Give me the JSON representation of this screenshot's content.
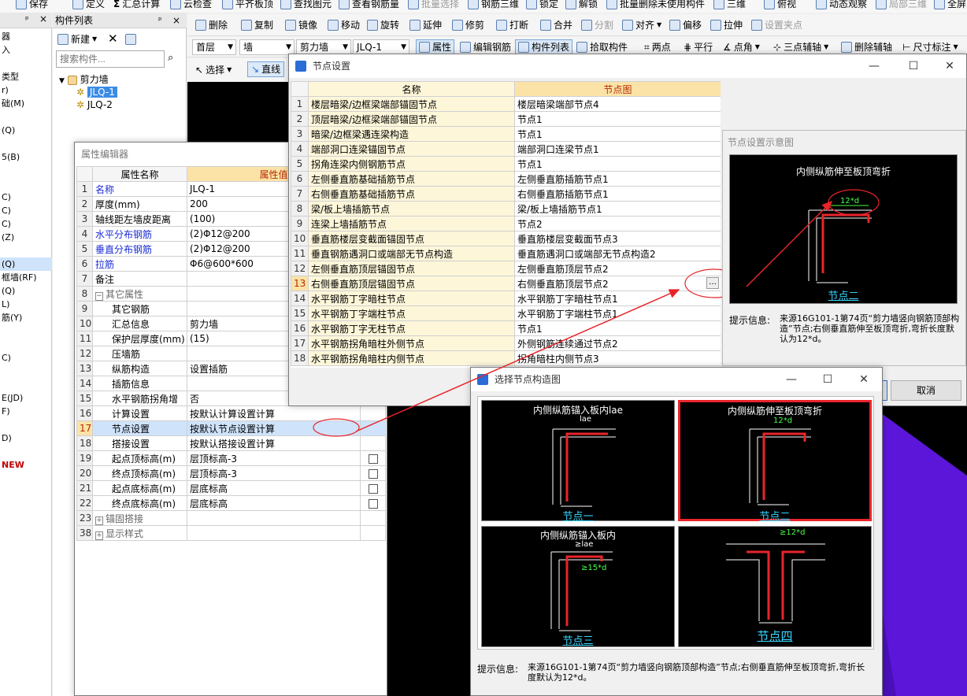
{
  "toolbar1": {
    "save": "保存",
    "define": "定义",
    "sum": "汇总计算",
    "cloud_check": "云检查",
    "flat_slab": "平齐板顶",
    "find": "查找图元",
    "view_rebar": "查看钢筋量",
    "batch_select": "批量选择",
    "rebar_3d": "钢筋三维",
    "lock": "锁定",
    "unlock": "解锁",
    "batch_delete": "批量删除未使用构件",
    "three_d": "三维",
    "top_view": "俯视",
    "dynamic": "动态观察",
    "local_3d": "局部三维",
    "full": "全屏"
  },
  "toolbar2": {
    "delete": "删除",
    "copy": "复制",
    "mirror": "镜像",
    "move": "移动",
    "rotate": "旋转",
    "extend": "延伸",
    "trim": "修剪",
    "break": "打断",
    "merge": "合并",
    "split": "分割",
    "align": "对齐",
    "offset": "偏移",
    "stretch": "拉伸",
    "set_corner": "设置夹点"
  },
  "toolbar3": {
    "floor": "首层",
    "type": "墙",
    "subtype": "剪力墙",
    "component": "JLQ-1",
    "property": "属性",
    "edit_rebar": "编辑钢筋",
    "comp_list": "构件列表",
    "pick": "拾取构件",
    "two_point": "两点",
    "parallel": "平行",
    "point_angle": "点角",
    "three_aux": "三点辅轴",
    "del_aux": "删除辅轴",
    "dim": "尺寸标注"
  },
  "toolbar4": {
    "select": "选择",
    "line": "直线"
  },
  "left_panel": {
    "items": [
      "器",
      "入",
      "",
      "类型",
      "r)",
      "础(M)",
      "",
      "(Q)",
      "",
      "5(B)",
      "",
      "",
      "C)",
      "C)",
      "C)",
      "(Z)",
      "",
      "(Q)",
      "框墙(RF)",
      "(Q)",
      "L)",
      "筋(Y)",
      "",
      "",
      "C)",
      "",
      "",
      "E(JD)",
      "F)",
      "",
      "D)",
      "",
      "NEW"
    ]
  },
  "comp_list": {
    "title": "构件列表",
    "new_btn": "新建",
    "search_placeholder": "搜索构件...",
    "tree_root": "剪力墙",
    "tree_items": [
      "JLQ-1",
      "JLQ-2"
    ]
  },
  "prop_editor": {
    "title": "属性编辑器",
    "col_name": "属性名称",
    "col_value": "属性值",
    "rows": [
      {
        "n": "1",
        "name": "名称",
        "value": "JLQ-1",
        "blue": true,
        "ind": 0
      },
      {
        "n": "2",
        "name": "厚度(mm)",
        "value": "200",
        "ind": 0
      },
      {
        "n": "3",
        "name": "轴线距左墙皮距离",
        "value": "(100)",
        "ind": 0
      },
      {
        "n": "4",
        "name": "水平分布钢筋",
        "value": "(2)Φ12@200",
        "blue": true,
        "ind": 0
      },
      {
        "n": "5",
        "name": "垂直分布钢筋",
        "value": "(2)Φ12@200",
        "blue": true,
        "ind": 0
      },
      {
        "n": "6",
        "name": "拉筋",
        "value": "Φ6@600*600",
        "blue": true,
        "ind": 0
      },
      {
        "n": "7",
        "name": "备注",
        "value": "",
        "ind": 0
      },
      {
        "n": "8",
        "name": "其它属性",
        "value": "",
        "group": "−",
        "ind": 0
      },
      {
        "n": "9",
        "name": "其它钢筋",
        "value": "",
        "ind": 1
      },
      {
        "n": "10",
        "name": "汇总信息",
        "value": "剪力墙",
        "ind": 1
      },
      {
        "n": "11",
        "name": "保护层厚度(mm)",
        "value": "(15)",
        "ind": 1
      },
      {
        "n": "12",
        "name": "压墙筋",
        "value": "",
        "ind": 1
      },
      {
        "n": "13",
        "name": "纵筋构造",
        "value": "设置插筋",
        "ind": 1
      },
      {
        "n": "14",
        "name": "插筋信息",
        "value": "",
        "ind": 1
      },
      {
        "n": "15",
        "name": "水平钢筋拐角增",
        "value": "否",
        "ind": 1
      },
      {
        "n": "16",
        "name": "计算设置",
        "value": "按默认计算设置计算",
        "ind": 1
      },
      {
        "n": "17",
        "name": "节点设置",
        "value": "按默认节点设置计算",
        "ind": 1,
        "sel": true
      },
      {
        "n": "18",
        "name": "搭接设置",
        "value": "按默认搭接设置计算",
        "ind": 1
      },
      {
        "n": "19",
        "name": "起点顶标高(m)",
        "value": "层顶标高-3",
        "ind": 1,
        "chk": true
      },
      {
        "n": "20",
        "name": "终点顶标高(m)",
        "value": "层顶标高-3",
        "ind": 1,
        "chk": true
      },
      {
        "n": "21",
        "name": "起点底标高(m)",
        "value": "层底标高",
        "ind": 1,
        "chk": true
      },
      {
        "n": "22",
        "name": "终点底标高(m)",
        "value": "层底标高",
        "ind": 1,
        "chk": true
      },
      {
        "n": "23",
        "name": "锚固搭接",
        "value": "",
        "group": "+",
        "ind": 0
      },
      {
        "n": "38",
        "name": "显示样式",
        "value": "",
        "group": "+",
        "ind": 0
      }
    ]
  },
  "node_dialog": {
    "title": "节点设置",
    "col_name": "名称",
    "col_node": "节点图",
    "cancel": "取消",
    "rows": [
      {
        "n": "1",
        "name": "楼层暗梁/边框梁端部锚固节点",
        "node": "楼层暗梁端部节点4"
      },
      {
        "n": "2",
        "name": "顶层暗梁/边框梁端部锚固节点",
        "node": "节点1"
      },
      {
        "n": "3",
        "name": "暗梁/边框梁遇连梁构造",
        "node": "节点1"
      },
      {
        "n": "4",
        "name": "端部洞口连梁锚固节点",
        "node": "端部洞口连梁节点1"
      },
      {
        "n": "5",
        "name": "拐角连梁内侧钢筋节点",
        "node": "节点1"
      },
      {
        "n": "6",
        "name": "左侧垂直筋基础插筋节点",
        "node": "左侧垂直筋插筋节点1"
      },
      {
        "n": "7",
        "name": "右侧垂直筋基础插筋节点",
        "node": "右侧垂直筋插筋节点1"
      },
      {
        "n": "8",
        "name": "梁/板上墙插筋节点",
        "node": "梁/板上墙插筋节点1"
      },
      {
        "n": "9",
        "name": "连梁上墙插筋节点",
        "node": "节点2"
      },
      {
        "n": "10",
        "name": "垂直筋楼层变截面锚固节点",
        "node": "垂直筋楼层变截面节点3"
      },
      {
        "n": "11",
        "name": "垂直钢筋遇洞口或端部无节点构造",
        "node": "垂直筋遇洞口或端部无节点构造2"
      },
      {
        "n": "12",
        "name": "左侧垂直筋顶层锚固节点",
        "node": "左侧垂直筋顶层节点2"
      },
      {
        "n": "13",
        "name": "右侧垂直筋顶层锚固节点",
        "node": "右侧垂直筋顶层节点2",
        "sel": true
      },
      {
        "n": "14",
        "name": "水平钢筋丁字暗柱节点",
        "node": "水平钢筋丁字暗柱节点1"
      },
      {
        "n": "15",
        "name": "水平钢筋丁字端柱节点",
        "node": "水平钢筋丁字端柱节点1"
      },
      {
        "n": "16",
        "name": "水平钢筋丁字无柱节点",
        "node": "节点1"
      },
      {
        "n": "17",
        "name": "水平钢筋拐角暗柱外侧节点",
        "node": "外侧钢筋连续通过节点2"
      },
      {
        "n": "18",
        "name": "水平钢筋拐角暗柱内侧节点",
        "node": "拐角暗柱内侧节点3"
      }
    ]
  },
  "preview_panel": {
    "title": "节点设置示意图",
    "diagram_title": "内侧纵筋伸至板顶弯折",
    "dim": "12*d",
    "node_label": "节点二",
    "hint_label": "提示信息:",
    "hint": "来源16G101-1第74页“剪力墙竖向钢筋顶部构造”节点;右侧垂直筋伸至板顶弯折,弯折长度默认为12*d。"
  },
  "select_dialog": {
    "title": "选择节点构造图",
    "hint_label": "提示信息:",
    "hint": "来源16G101-1第74页“剪力墙竖向钢筋顶部构造”节点;右侧垂直筋伸至板顶弯折,弯折长度默认为12*d。",
    "cells": [
      {
        "title": "内侧纵筋锚入板内lae",
        "dim": "lae",
        "label": "节点一"
      },
      {
        "title": "内侧纵筋伸至板顶弯折",
        "dim": "12*d",
        "label": "节点二",
        "selected": true
      },
      {
        "title": "内侧纵筋锚入板内",
        "dim": "≥lae",
        "dim2": "≥15*d",
        "label": "节点三"
      },
      {
        "title": "",
        "dim": "≥12*d",
        "label": "节点四"
      }
    ]
  },
  "colors": {
    "accent_red": "#e8242b",
    "cad_cyan": "#37d6ff",
    "cad_green": "#49ff49",
    "selected_row": "#cfe3fb",
    "header_orange": "#fbe3a8"
  }
}
